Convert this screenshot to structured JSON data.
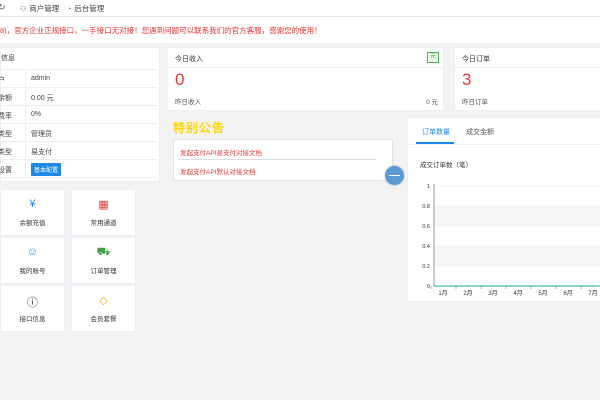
{
  "topbar": {
    "refresh_icon": "↻",
    "nav": [
      {
        "icon": "user-icon",
        "label": "商户管理"
      },
      {
        "icon": "dashboard-icon",
        "label": "后台管理"
      }
    ]
  },
  "notice": {
    "text": "8)，官方企业正规接口，一手接口无对接！您遇到问题可以联系我们的官方客服，感谢您的使用！"
  },
  "merchant_info": {
    "title": "信息",
    "rows": [
      {
        "key": "户",
        "value": "admin"
      },
      {
        "key": "余额",
        "value": "0.00 元"
      },
      {
        "key": "费率",
        "value": "0%"
      },
      {
        "key": "类型",
        "value": "管理员"
      },
      {
        "key": "类型",
        "value": "易支付"
      },
      {
        "key": "设置",
        "value": "基本配置"
      }
    ]
  },
  "stats": [
    {
      "title": "今日收入",
      "tag": "元",
      "value": "0",
      "sub_label": "昨日收入",
      "sub_value": "0 元"
    },
    {
      "title": "今日订单",
      "value": "3",
      "sub_label": "昨日订单"
    }
  ],
  "tiles": [
    {
      "label": "余额充值",
      "icon": "yen-icon",
      "glyph": "¥",
      "color": "#1e88e5"
    },
    {
      "label": "常用通道",
      "icon": "grid-icon",
      "glyph": "▦",
      "color": "#e53935"
    },
    {
      "label": "我的账号",
      "icon": "user-icon",
      "glyph": "☺",
      "color": "#1e88e5"
    },
    {
      "label": "订单管理",
      "icon": "cart-icon",
      "glyph": "🛒",
      "color": "#43a047"
    },
    {
      "label": "接口信息",
      "icon": "info-icon",
      "glyph": "ⓘ",
      "color": "#333"
    },
    {
      "label": "会员套餐",
      "icon": "diamond-icon",
      "glyph": "◇",
      "color": "#f5a623"
    }
  ],
  "announcement": {
    "heading": "特别公告",
    "items": [
      "发起支付API易支付对接文档",
      "发起支付API默认对接文档"
    ]
  },
  "chart_panel": {
    "tabs": [
      "订单数量",
      "成交金额"
    ],
    "active_tab": 0
  },
  "chart_data": {
    "type": "line",
    "title": "成交订单数（笔）",
    "categories": [
      "1月",
      "2月",
      "3月",
      "4月",
      "5月",
      "6月",
      "7月"
    ],
    "series": [
      {
        "values": [
          0,
          0,
          0,
          0,
          0,
          0,
          0
        ]
      }
    ],
    "ylim": [
      0,
      1
    ],
    "yticks": [
      "0",
      "0.2",
      "0.4",
      "0.6",
      "0.8",
      "1"
    ],
    "grid": true
  },
  "colors": {
    "accent": "#1e88e5",
    "danger": "#e53935",
    "chart_line": "#26a69a",
    "announce": "#ffd400"
  }
}
